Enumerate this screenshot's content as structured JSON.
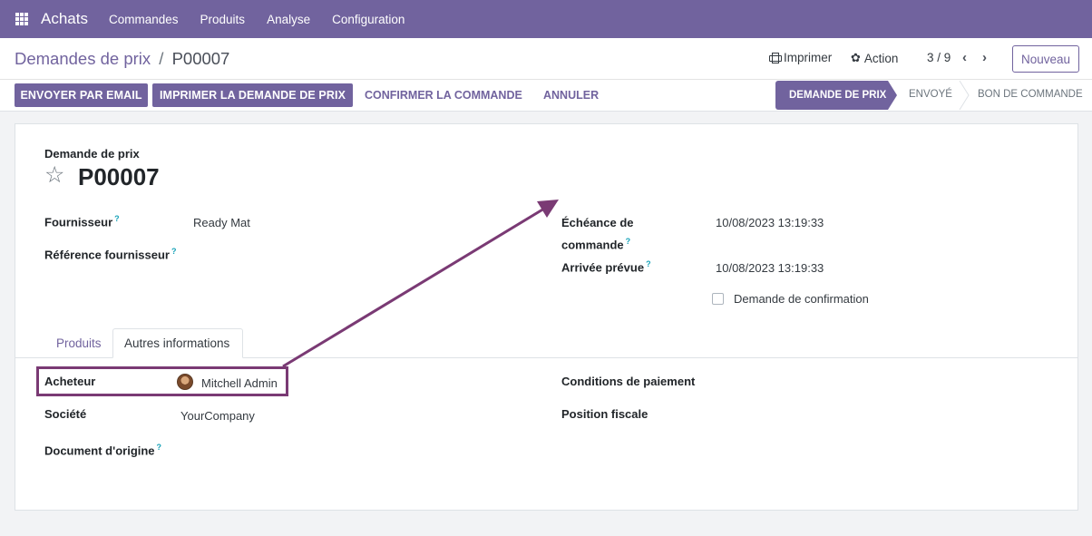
{
  "navbar": {
    "app_name": "Achats",
    "menu": [
      "Commandes",
      "Produits",
      "Analyse",
      "Configuration"
    ]
  },
  "control_panel": {
    "breadcrumb_parent": "Demandes de prix",
    "breadcrumb_separator": "/",
    "breadcrumb_current": "P00007",
    "print_label": "Imprimer",
    "action_label": "Action",
    "pager": "3 / 9",
    "new_label": "Nouveau"
  },
  "status_actions": {
    "send_email": "ENVOYER PAR EMAIL",
    "print_rfq": "IMPRIMER LA DEMANDE DE PRIX",
    "confirm_order": "CONFIRMER LA COMMANDE",
    "cancel": "ANNULER"
  },
  "stages": {
    "active": "DEMANDE DE PRIX",
    "sent": "ENVOYÉ",
    "purchase_order": "BON DE COMMANDE"
  },
  "form": {
    "doc_type_label": "Demande de prix",
    "doc_number": "P00007",
    "supplier_label": "Fournisseur",
    "supplier_value": "Ready Mat",
    "supplier_ref_label": "Référence fournisseur",
    "deadline_label_line1": "Échéance de",
    "deadline_label_line2": "commande",
    "deadline_value": "10/08/2023 13:19:33",
    "expected_arrival_label": "Arrivée prévue",
    "expected_arrival_value": "10/08/2023 13:19:33",
    "confirmation_request_label": "Demande de confirmation",
    "tooltip_marker": "?"
  },
  "tabs": {
    "products": "Produits",
    "other_info": "Autres informations"
  },
  "other_info": {
    "buyer_label": "Acheteur",
    "buyer_value": "Mitchell Admin",
    "company_label": "Société",
    "company_value": "YourCompany",
    "source_doc_label": "Document d'origine",
    "payment_terms_label": "Conditions de paiement",
    "fiscal_position_label": "Position fiscale"
  },
  "colors": {
    "brand": "#71639e",
    "annotation": "#7a3a74"
  }
}
